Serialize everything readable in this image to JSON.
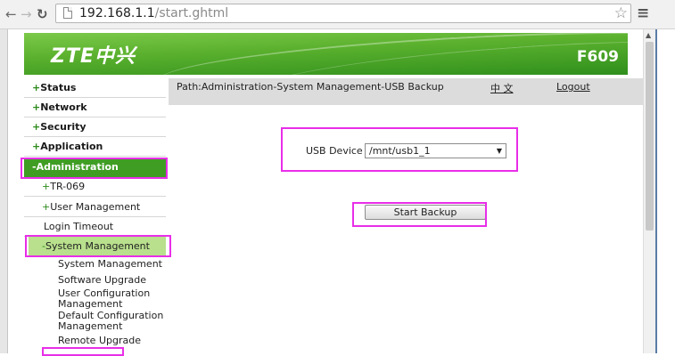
{
  "browser": {
    "url_host": "192.168.1.1",
    "url_path": "/start.ghtml",
    "back_icon": "arrow-left-icon",
    "forward_icon": "arrow-right-icon",
    "reload_icon": "reload-icon",
    "star_icon": "star-icon",
    "menu_icon": "hamburger-menu-icon"
  },
  "header": {
    "logo": "ZTE中兴",
    "model": "F609",
    "brand_color": "#3f9d24"
  },
  "sidebar": {
    "items": [
      {
        "symbol": "+",
        "label": "Status"
      },
      {
        "symbol": "+",
        "label": "Network"
      },
      {
        "symbol": "+",
        "label": "Security"
      },
      {
        "symbol": "+",
        "label": "Application"
      },
      {
        "symbol": "-",
        "label": "Administration"
      },
      {
        "symbol": "+",
        "label": "TR-069"
      },
      {
        "symbol": "+",
        "label": "User Management"
      },
      {
        "symbol": "",
        "label": "Login Timeout"
      },
      {
        "symbol": "-",
        "label": "System Management"
      }
    ],
    "leaves": [
      "System Management",
      "Software Upgrade",
      "User Configuration Management",
      "Default Configuration Management",
      "Remote Upgrade"
    ]
  },
  "main": {
    "path": "Path:Administration-System Management-USB Backup",
    "lang_link": "中 文",
    "logout_link": "Logout",
    "usb_label": "USB Device",
    "usb_value": "/mnt/usb1_1",
    "start_button": "Start Backup"
  },
  "annotation_color": "#e82ee8"
}
